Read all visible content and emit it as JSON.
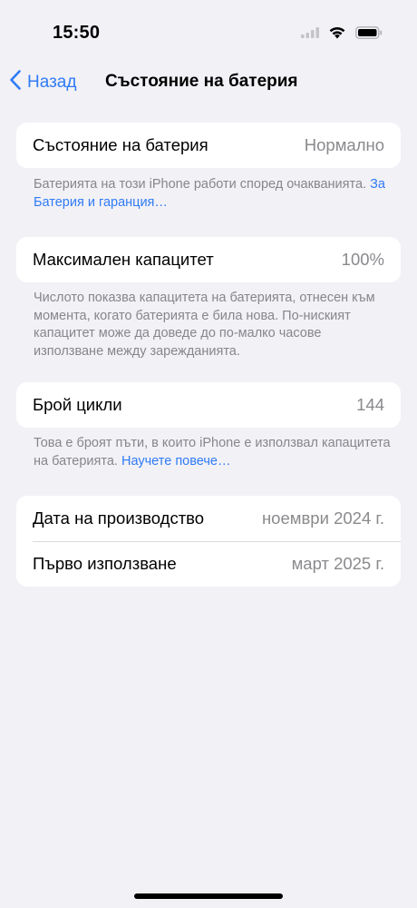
{
  "status_bar": {
    "time": "15:50",
    "icons": [
      "cellular-signal-icon",
      "wifi-icon",
      "battery-icon"
    ]
  },
  "nav": {
    "back_label": "Назад",
    "title": "Състояние на батерия"
  },
  "battery_state": {
    "label": "Състояние на батерия",
    "value": "Нормално",
    "footnote": "Батерията на този iPhone работи според очакванията.",
    "link": "За Батерия и гаранция…"
  },
  "max_capacity": {
    "label": "Максимален капацитет",
    "value": "100%",
    "footnote": "Числото показва капацитета на батерията, отнесен към момента, когато батерията е била нова. По-ниският капацитет може да доведе до по-малко часове използване между зарежданията."
  },
  "cycle_count": {
    "label": "Брой цикли",
    "value": "144",
    "footnote": "Това е броят пъти, в които iPhone е използвал капацитета на батерията.",
    "link": "Научете повече…"
  },
  "dates": {
    "manufacture_label": "Дата на производство",
    "manufacture_value": "ноември 2024 г.",
    "first_use_label": "Първо използване",
    "first_use_value": "март 2025 г."
  },
  "colors": {
    "background": "#f2f1f6",
    "card": "#ffffff",
    "accent": "#2f7bf5",
    "secondary_text": "#8a8a8e"
  }
}
